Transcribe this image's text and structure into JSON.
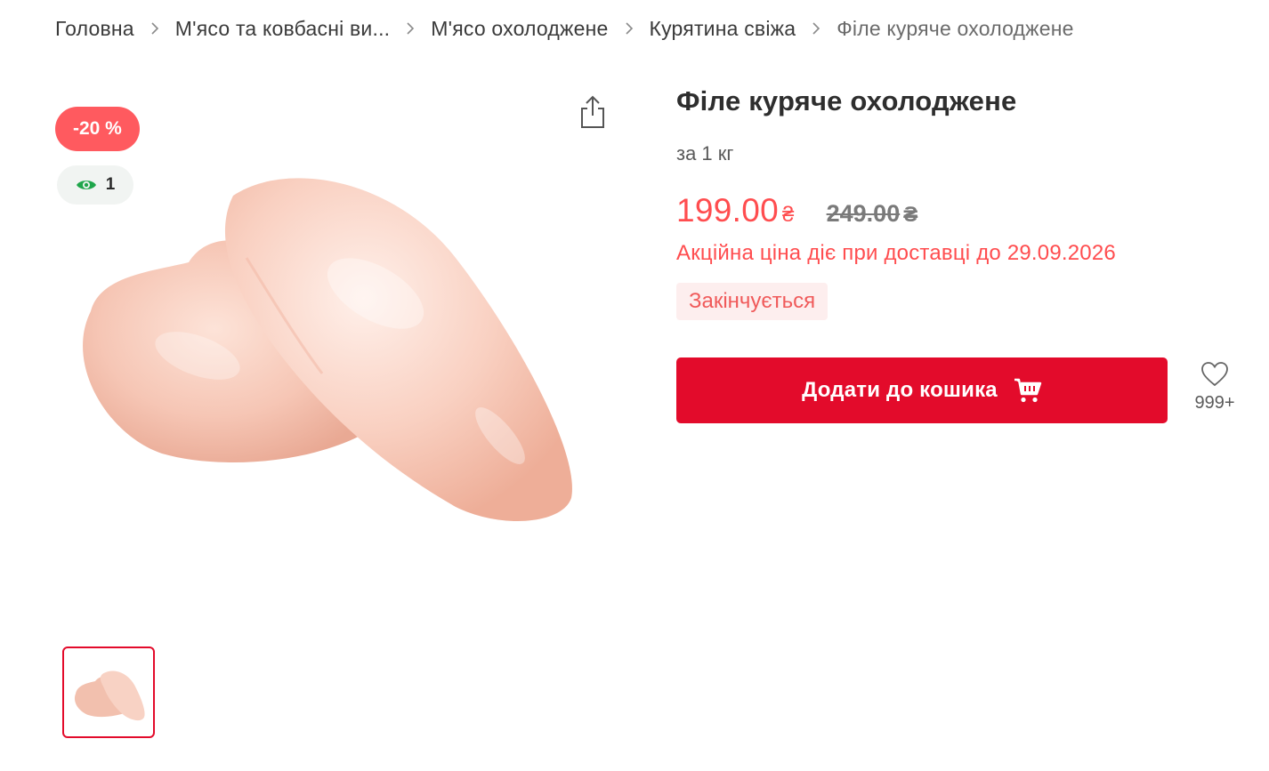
{
  "breadcrumbs": [
    {
      "label": "Головна"
    },
    {
      "label": "М'ясо та ковбасні ви..."
    },
    {
      "label": "М'ясо охолоджене"
    },
    {
      "label": "Курятина свіжа"
    },
    {
      "label": "Філе куряче охолоджене"
    }
  ],
  "gallery": {
    "discount_badge": "-20 %",
    "views_count": "1",
    "icons": {
      "share": "share-icon",
      "views": "eye-icon"
    }
  },
  "product": {
    "title": "Філе куряче охолоджене",
    "unit": "за 1 кг",
    "price_new": "199.00",
    "price_old": "249.00",
    "currency": "₴",
    "promo_text": "Акційна ціна діє при доставці до 29.09.2026",
    "stock_status": "Закінчується",
    "add_to_cart_label": "Додати до кошика",
    "favorites_count": "999+"
  },
  "colors": {
    "accent_red": "#e30b2b",
    "discount_red": "#ff4d4f",
    "badge_red": "#ff5a5f",
    "stock_bg": "#fdeeee"
  }
}
